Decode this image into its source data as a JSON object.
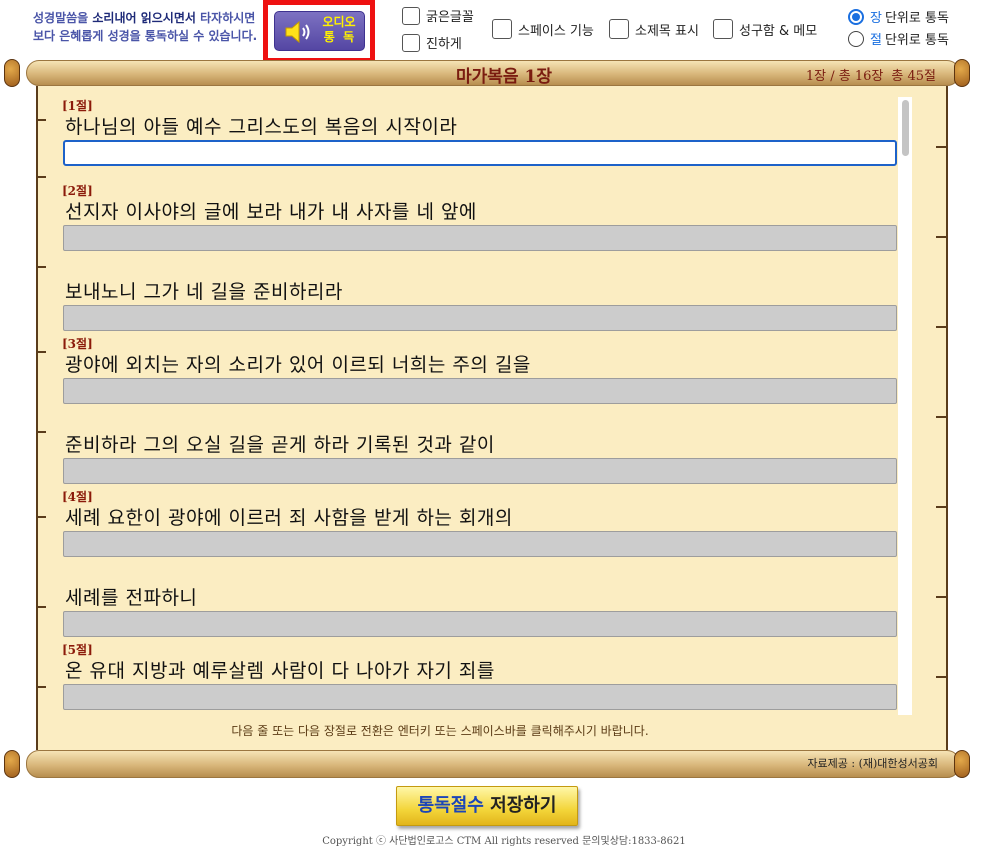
{
  "intro": {
    "line1_a": "성경말씀을 ",
    "line1_b": "소리내어 읽으시면서",
    "line1_c": " 타자하시면",
    "line2": "보다 은혜롭게 성경을 통독하실 수 있습니다."
  },
  "audio_button": {
    "line1": "오디오",
    "line2": "통  독"
  },
  "options": {
    "bold_font": "굵은글꼴",
    "darker": "진하게",
    "space_feature": "스페이스 기능",
    "subtitle_show": "소제목 표시",
    "verse_memo": "성구함 & 메모"
  },
  "mode": {
    "chapter_accent": "장",
    "chapter_rest": "단위로 통독",
    "verse_accent": "절",
    "verse_rest": "단위로 통독",
    "selected": "chapter"
  },
  "header": {
    "title": "마가복음 1장",
    "chapter_pos": "1장 / 총 16장",
    "verse_total": "총 45절"
  },
  "verses": [
    {
      "num": "[1절]",
      "text": "하나님의 아들 예수 그리스도의 복음의 시작이라",
      "active": true
    },
    {
      "num": "[2절]",
      "text": "선지자 이사야의 글에 보라 내가 내 사자를 네 앞에",
      "active": false
    },
    {
      "num": "",
      "text": "보내노니 그가 네 길을 준비하리라",
      "active": false
    },
    {
      "num": "[3절]",
      "text": "광야에 외치는 자의 소리가 있어 이르되 너희는 주의 길을",
      "active": false
    },
    {
      "num": "",
      "text": "준비하라 그의 오실 길을 곧게 하라 기록된 것과 같이",
      "active": false
    },
    {
      "num": "[4절]",
      "text": "세례 요한이 광야에 이르러 죄 사함을 받게 하는 회개의",
      "active": false
    },
    {
      "num": "",
      "text": "세례를 전파하니",
      "active": false
    },
    {
      "num": "[5절]",
      "text": "온 유대 지방과 예루살렘 사람이 다 나아가 자기 죄를",
      "active": false
    }
  ],
  "hint": "다음 줄 또는 다음 장절로 전환은 엔터키 또는 스페이스바를 클릭해주시기 바랍니다.",
  "source": "자료제공 : (재)대한성서공회",
  "save_button": {
    "part1": "통독절수",
    "part2": "저장하기"
  },
  "copyright": "Copyright ⓒ 사단법인로고스 CTM All rights reserved 문의및상담:1833-8621",
  "icons": {
    "audio": "speaker-icon"
  },
  "colors": {
    "accent": "#1a6fe0",
    "verse_number": "#8b1a0a",
    "title": "#7a1c10",
    "highlight": "#ee1111"
  }
}
